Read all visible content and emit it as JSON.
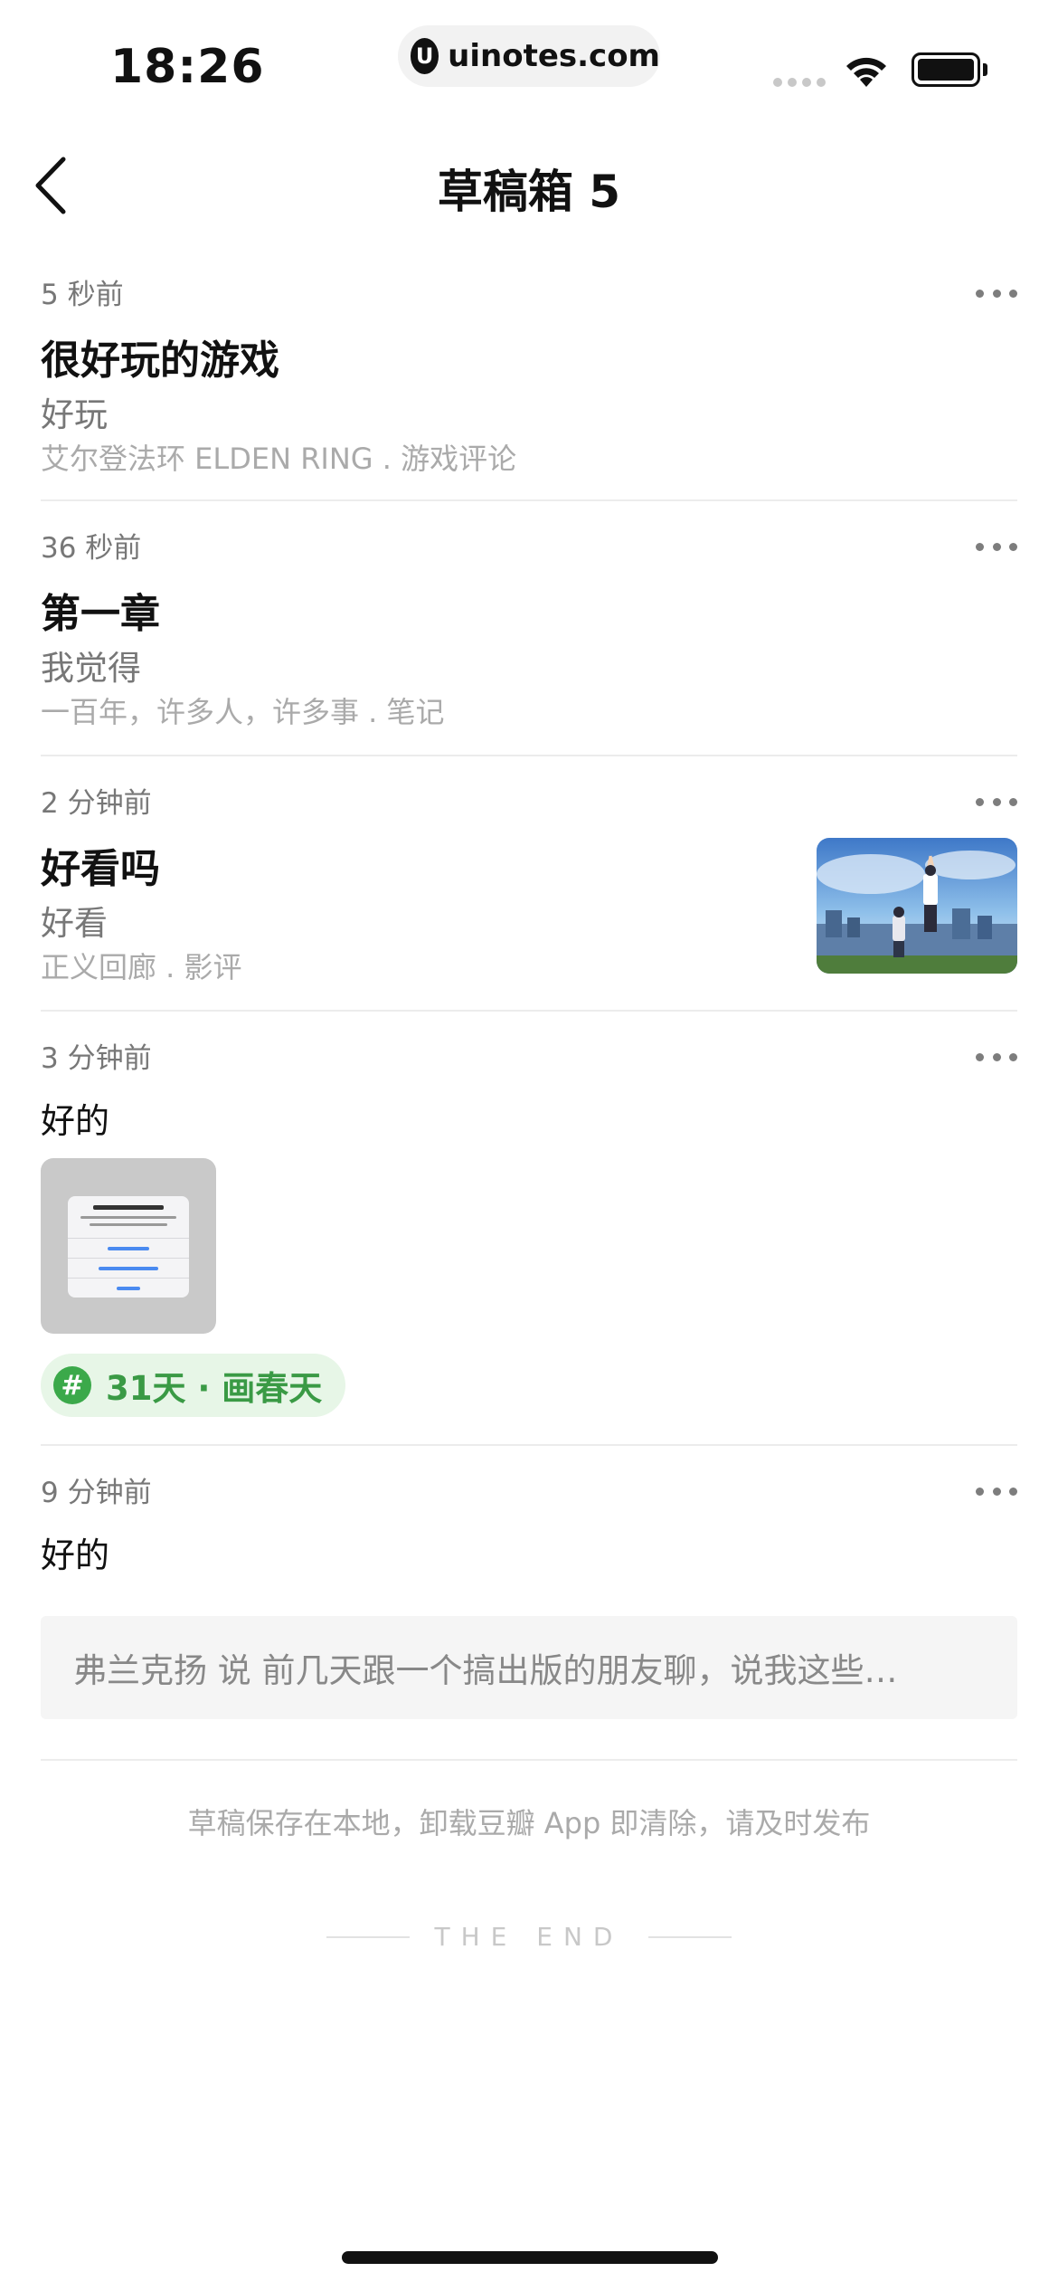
{
  "status_bar": {
    "time": "18:26",
    "url": "uinotes.com",
    "url_logo_letter": "U"
  },
  "nav": {
    "title": "草稿箱 5",
    "back_icon": "chevron-left-icon"
  },
  "drafts": [
    {
      "time": "5 秒前",
      "title": "很好玩的游戏",
      "body": "好玩",
      "meta": "艾尔登法环 ELDEN RING . 游戏评论"
    },
    {
      "time": "36 秒前",
      "title": "第一章",
      "body": "我觉得",
      "meta": "一百年，许多人，许多事 . 笔记"
    },
    {
      "time": "2 分钟前",
      "title": "好看吗",
      "body": "好看",
      "meta": "正义回廊 . 影评",
      "thumbnail": "anime-scene-image"
    },
    {
      "time": "3 分钟前",
      "text": "好的",
      "image": "permission-dialog-screenshot",
      "topic": "31天 · 画春天",
      "topic_icon": "#"
    },
    {
      "time": "9 分钟前",
      "text": "好的",
      "quote": "弗兰克扬 说 前几天跟一个搞出版的朋友聊，说我这些…"
    }
  ],
  "footer": {
    "note": "草稿保存在本地，卸载豆瓣 App 即清除，请及时发布",
    "end": "THE END"
  },
  "colors": {
    "topic_green": "#3ba94a",
    "topic_bg": "#e7f6e7",
    "divider": "#ececec"
  }
}
